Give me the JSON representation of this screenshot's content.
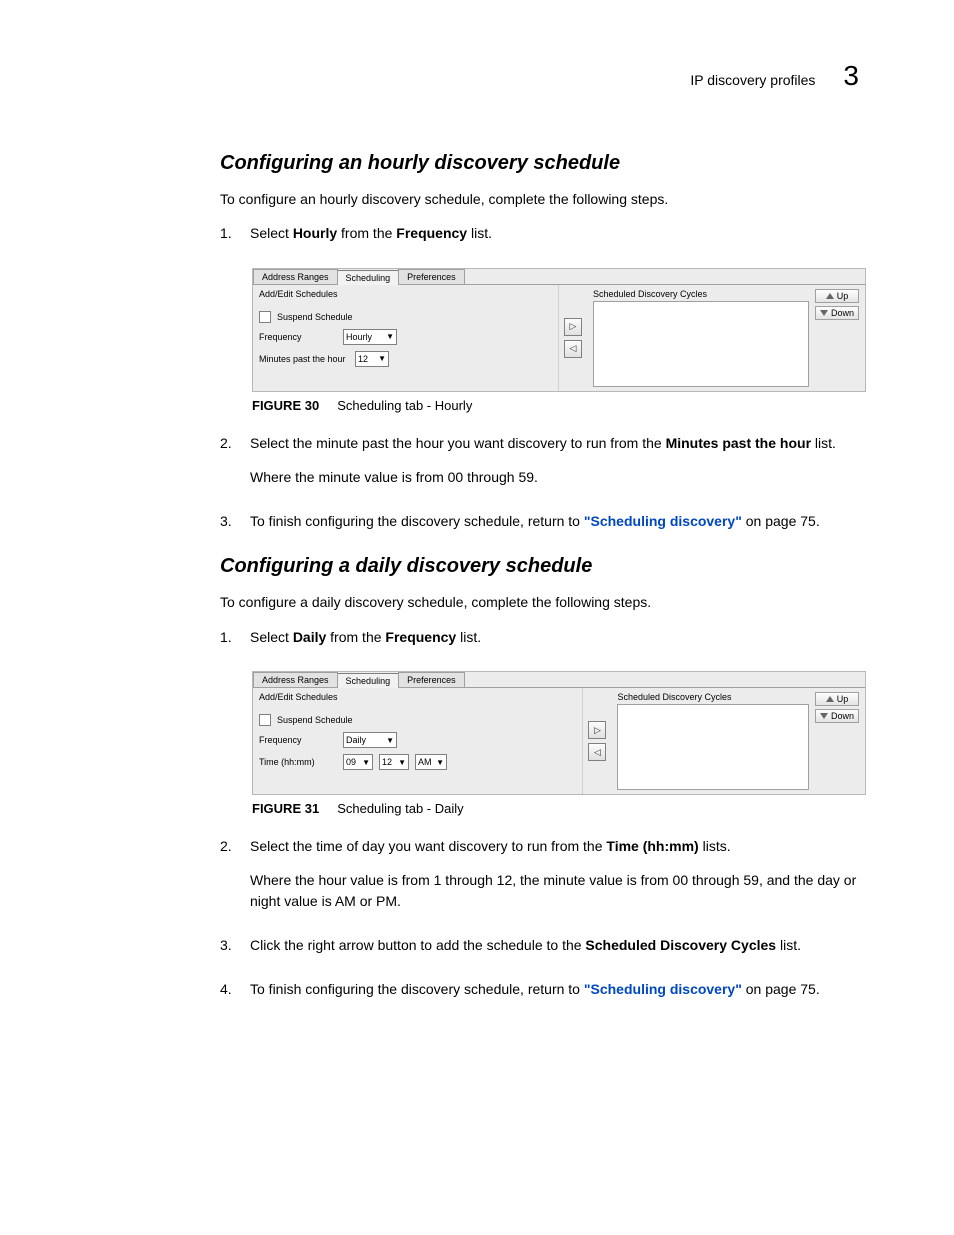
{
  "header": {
    "section": "IP discovery profiles",
    "chapter": "3"
  },
  "sectionA": {
    "title": "Configuring an hourly discovery schedule",
    "intro": "To configure an hourly discovery schedule, complete the following steps.",
    "step1_pre": "Select ",
    "step1_b1": "Hourly",
    "step1_mid": " from the ",
    "step1_b2": "Frequency",
    "step1_post": " list.",
    "fig_label": "FIGURE 30",
    "fig_title": "Scheduling tab - Hourly",
    "step2_pre": "Select the minute past the hour you want discovery to run from the ",
    "step2_b": "Minutes past the hour",
    "step2_post": " list.",
    "step2_p2": "Where the minute value is from 00 through 59.",
    "step3_pre": "To finish configuring the discovery schedule, return to ",
    "step3_link": "\"Scheduling discovery\"",
    "step3_post": " on page 75."
  },
  "sectionB": {
    "title": "Configuring a daily discovery schedule",
    "intro": "To configure a daily discovery schedule, complete the following steps.",
    "step1_pre": "Select ",
    "step1_b1": "Daily",
    "step1_mid": " from the ",
    "step1_b2": "Frequency",
    "step1_post": " list.",
    "fig_label": "FIGURE 31",
    "fig_title": "Scheduling tab - Daily",
    "step2_pre": "Select the time of day you want discovery to run from the ",
    "step2_b": "Time (hh:mm)",
    "step2_post": " lists.",
    "step2_p2": "Where the hour value is from 1 through 12, the minute value is from 00 through 59, and the day or night value is AM or PM.",
    "step3_pre": "Click the right arrow button to add the schedule to the ",
    "step3_b": "Scheduled Discovery Cycles",
    "step3_post": " list.",
    "step4_pre": "To finish configuring the discovery schedule, return to ",
    "step4_link": "\"Scheduling discovery\"",
    "step4_post": " on page 75."
  },
  "ui": {
    "tabs": {
      "t1": "Address Ranges",
      "t2": "Scheduling",
      "t3": "Preferences"
    },
    "left_title": "Add/Edit Schedules",
    "suspend": "Suspend Schedule",
    "freq_label": "Frequency",
    "right_title": "Scheduled Discovery Cycles",
    "up": "Up",
    "down": "Down",
    "hourly": {
      "value": "Hourly",
      "mph_label": "Minutes past the hour",
      "mph_value": "12"
    },
    "daily": {
      "value": "Daily",
      "time_label": "Time (hh:mm)",
      "hh": "09",
      "mm": "12",
      "ampm": "AM"
    }
  }
}
